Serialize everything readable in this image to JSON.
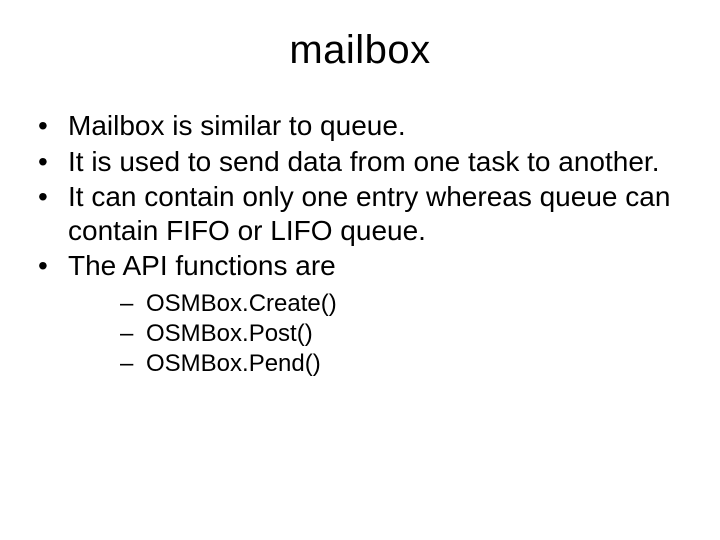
{
  "slide": {
    "title": "mailbox",
    "bullets": [
      "Mailbox is similar to queue.",
      "It is used to send data from one task to another.",
      "It can contain only one entry whereas queue can contain FIFO or LIFO queue.",
      "The API functions are"
    ],
    "subitems": [
      "OSMBox.Create()",
      "OSMBox.Post()",
      "OSMBox.Pend()"
    ]
  }
}
